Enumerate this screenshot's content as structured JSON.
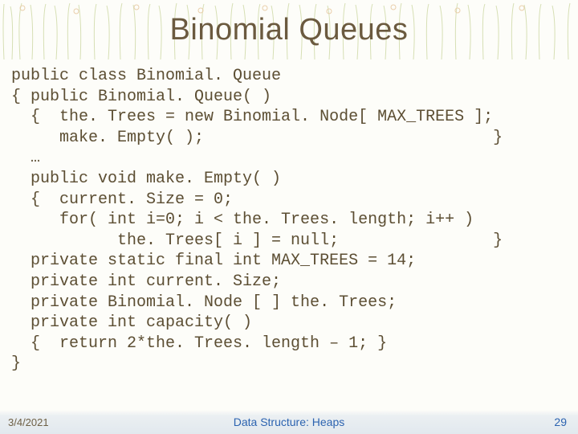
{
  "slide": {
    "title": "Binomial Queues"
  },
  "code": {
    "l01": "public class Binomial. Queue",
    "l02": "{ public Binomial. Queue( )",
    "l03": "  {  the. Trees = new Binomial. Node[ MAX_TREES ];",
    "l04": "     make. Empty( );                              }",
    "l05": "  …",
    "l06": "  public void make. Empty( )",
    "l07": "  {  current. Size = 0;",
    "l08": "     for( int i=0; i < the. Trees. length; i++ )",
    "l09": "           the. Trees[ i ] = null;                }",
    "l10": "  private static final int MAX_TREES = 14;",
    "l11": "  private int current. Size;",
    "l12": "  private Binomial. Node [ ] the. Trees;",
    "l13": "  private int capacity( )",
    "l14": "  {  return 2*the. Trees. length – 1; }",
    "l15": "}"
  },
  "footer": {
    "date": "3/4/2021",
    "course": "Data Structure: Heaps",
    "page": "29"
  }
}
